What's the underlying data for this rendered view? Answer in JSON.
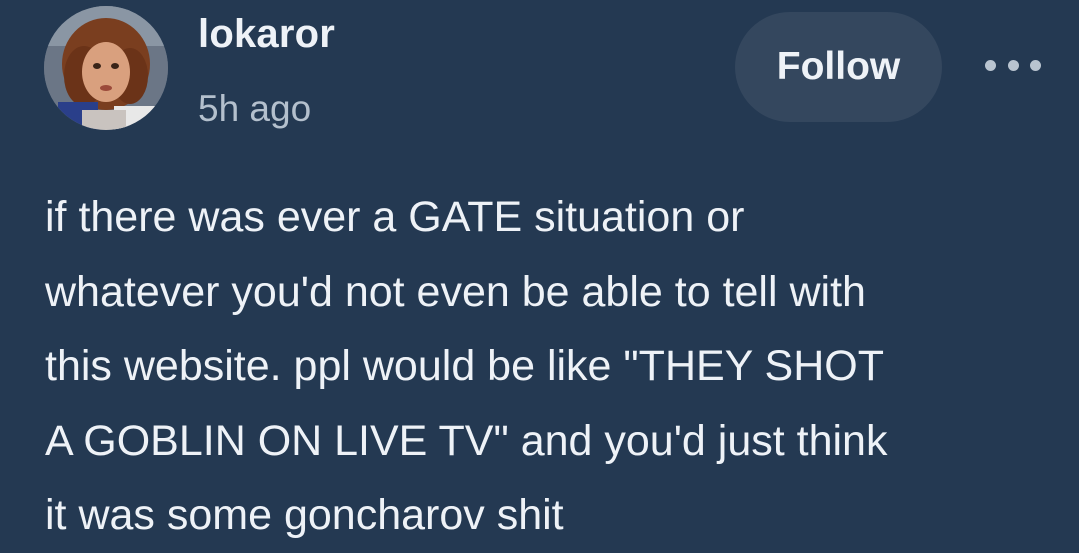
{
  "post": {
    "author": "lokaror",
    "timestamp": "5h ago",
    "follow_label": "Follow",
    "more_icon": "more-horizontal-icon",
    "body_lines": [
      "if there was ever a GATE situation or",
      "whatever you'd not even be able to tell with",
      "this website. ppl would be like \"THEY SHOT",
      "A GOBLIN ON LIVE TV\" and you'd just think",
      "it was some goncharov shit"
    ]
  },
  "colors": {
    "background": "#243952",
    "button_bg": "#34475e",
    "text_primary": "#eef2f7",
    "text_secondary": "#b4c0cd"
  }
}
